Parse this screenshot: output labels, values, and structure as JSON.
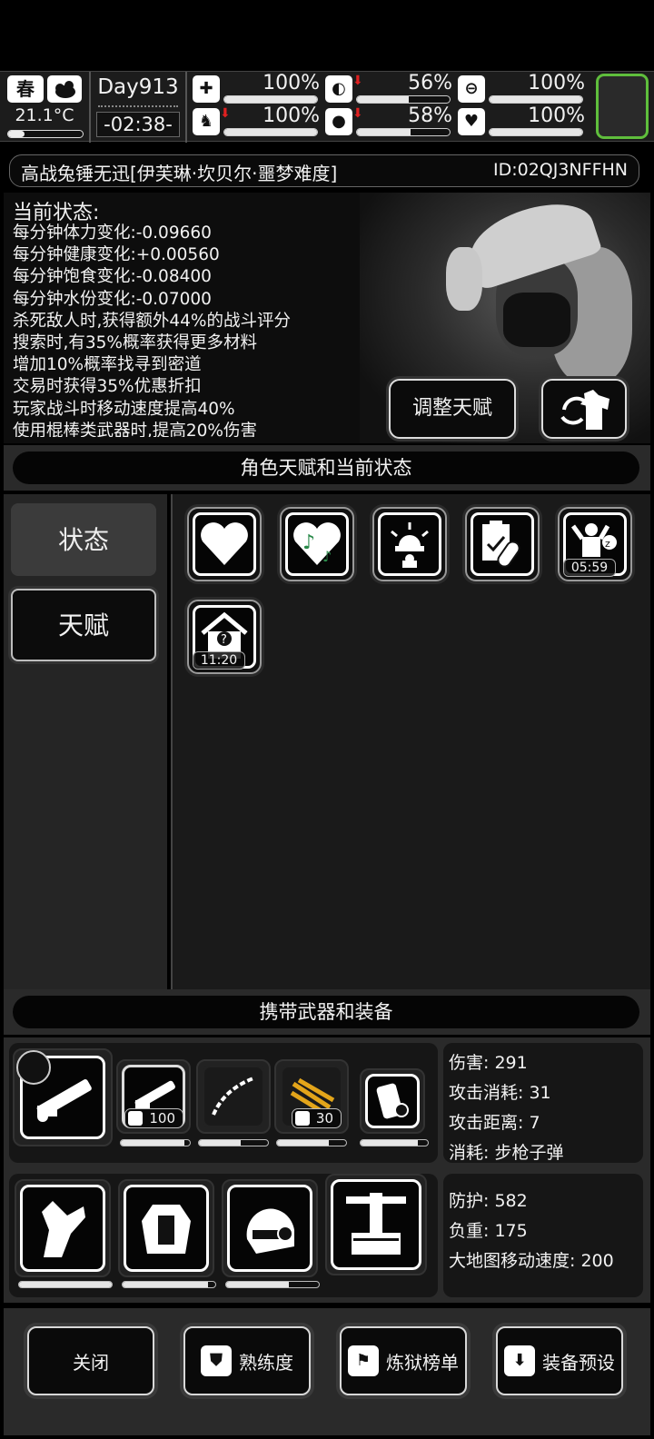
{
  "topbar": {
    "season": "春",
    "temperature": "21.1°C",
    "temperature_level": 0.22,
    "day": "Day913",
    "clock": "-02:38-",
    "stats": [
      {
        "name": "health",
        "value": "100%",
        "level": 1.0,
        "declining": false
      },
      {
        "name": "hunger",
        "value": "56%",
        "level": 0.56,
        "declining": true
      },
      {
        "name": "stamina",
        "value": "100%",
        "level": 1.0,
        "declining": false
      },
      {
        "name": "leg",
        "value": "100%",
        "level": 1.0,
        "declining": true
      },
      {
        "name": "water",
        "value": "58%",
        "level": 0.58,
        "declining": true
      },
      {
        "name": "mood",
        "value": "100%",
        "level": 1.0,
        "declining": false
      }
    ]
  },
  "character": {
    "name": "高战兔锤无迅[伊芙琳·坎贝尔·噩梦难度]",
    "id": "ID:02QJ3NFFHN"
  },
  "status": {
    "title": "当前状态:",
    "lines": [
      "每分钟体力变化:-0.09660",
      "每分钟健康变化:+0.00560",
      "每分钟饱食变化:-0.08400",
      "每分钟水份变化:-0.07000",
      "杀死敌人时,获得额外44%的战斗评分",
      "搜索时,有35%概率获得更多材料",
      "增加10%概率找寻到密道",
      "交易时获得35%优惠折扣",
      "玩家战斗时移动速度提高40%",
      "使用棍棒类武器时,提高20%伤害"
    ],
    "adjust_talent_label": "调整天赋"
  },
  "talent_section": {
    "header": "角色天赋和当前状态",
    "tabs": [
      "状态",
      "天赋"
    ],
    "tiles": [
      {
        "icon": "heart-icon",
        "timer": ""
      },
      {
        "icon": "music-heart-icon",
        "timer": ""
      },
      {
        "icon": "alarm-icon",
        "timer": ""
      },
      {
        "icon": "medicine-icon",
        "timer": ""
      },
      {
        "icon": "sleep-icon",
        "timer": "05:59"
      },
      {
        "icon": "shelter-icon",
        "timer": "11:20"
      }
    ]
  },
  "equip_section": {
    "header": "携带武器和装备",
    "weapons": [
      {
        "icon": "minigun-icon",
        "count": "",
        "durability": 1.0
      },
      {
        "icon": "minigun-small-icon",
        "count": "100",
        "durability": 0.92
      },
      {
        "icon": "chain-icon",
        "count": "",
        "durability": 0.6
      },
      {
        "icon": "ammo-belt-icon",
        "count": "30",
        "durability": 0.75
      },
      {
        "icon": "canister-icon",
        "count": "",
        "durability": 0.85
      }
    ],
    "armor": [
      {
        "icon": "gauntlet-icon",
        "durability": 1.0
      },
      {
        "icon": "body-armor-icon",
        "durability": 0.92
      },
      {
        "icon": "helmet-icon",
        "durability": 0.68
      },
      {
        "icon": "backpack-frame-icon",
        "durability": 0
      }
    ],
    "weapon_stats": [
      "伤害: 291",
      "攻击消耗: 31",
      "攻击距离: 7",
      "消耗: 步枪子弹"
    ],
    "armor_stats": [
      "防护: 582",
      "负重: 175",
      "大地图移动速度: 200"
    ]
  },
  "bottom_buttons": [
    {
      "label": "关闭",
      "icon": ""
    },
    {
      "label": "熟练度",
      "icon": "proficiency-icon"
    },
    {
      "label": "炼狱榜单",
      "icon": "banner-icon"
    },
    {
      "label": "装备预设",
      "icon": "equip-preset-icon"
    }
  ],
  "colors": {
    "accent_green": "#5fbe3c",
    "alert_red": "#e02020"
  }
}
